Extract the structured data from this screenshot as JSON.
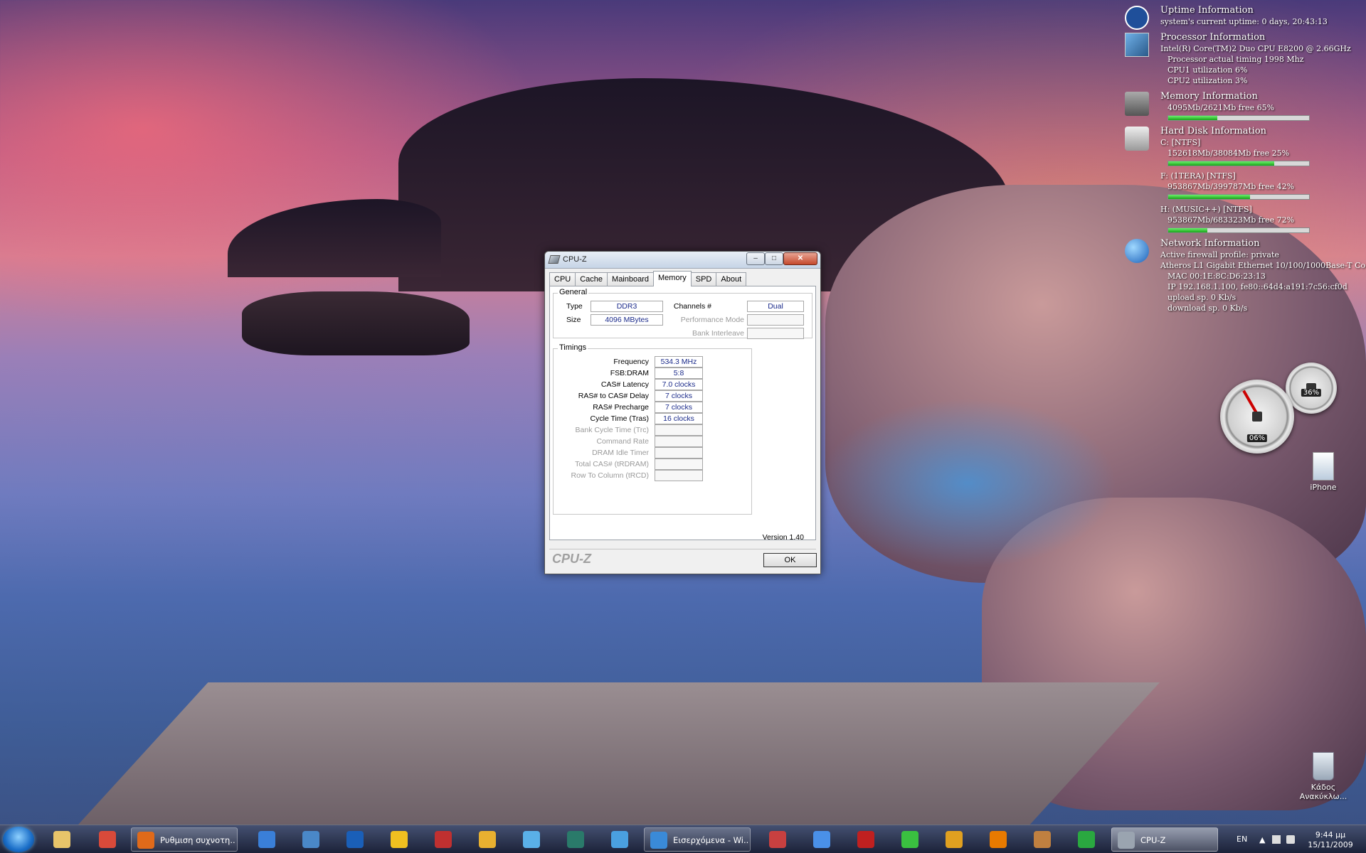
{
  "window": {
    "title": "CPU-Z",
    "tabs": [
      "CPU",
      "Cache",
      "Mainboard",
      "Memory",
      "SPD",
      "About"
    ],
    "active_tab": "Memory",
    "general": {
      "legend": "General",
      "type_label": "Type",
      "type_value": "DDR3",
      "size_label": "Size",
      "size_value": "4096 MBytes",
      "channels_label": "Channels #",
      "channels_value": "Dual",
      "perf_mode_label": "Performance Mode",
      "bank_interleave_label": "Bank Interleave"
    },
    "timings": {
      "legend": "Timings",
      "rows": [
        {
          "label": "Frequency",
          "value": "534.3 MHz",
          "enabled": true
        },
        {
          "label": "FSB:DRAM",
          "value": "5:8",
          "enabled": true
        },
        {
          "label": "CAS# Latency",
          "value": "7.0 clocks",
          "enabled": true
        },
        {
          "label": "RAS# to CAS# Delay",
          "value": "7 clocks",
          "enabled": true
        },
        {
          "label": "RAS# Precharge",
          "value": "7 clocks",
          "enabled": true
        },
        {
          "label": "Cycle Time (Tras)",
          "value": "16 clocks",
          "enabled": true
        },
        {
          "label": "Bank Cycle Time (Trc)",
          "value": "",
          "enabled": false
        },
        {
          "label": "Command Rate",
          "value": "",
          "enabled": false
        },
        {
          "label": "DRAM Idle Timer",
          "value": "",
          "enabled": false
        },
        {
          "label": "Total CAS# (tRDRAM)",
          "value": "",
          "enabled": false
        },
        {
          "label": "Row To Column (tRCD)",
          "value": "",
          "enabled": false
        }
      ]
    },
    "version": "Version 1.40",
    "brand": "CPU-Z",
    "ok_label": "OK"
  },
  "gadget": {
    "uptime": {
      "title": "Uptime Information",
      "line": "system's current uptime: 0 days, 20:43:13"
    },
    "processor": {
      "title": "Processor Information",
      "lines": [
        "Intel(R) Core(TM)2 Duo CPU     E8200  @ 2.66GHz",
        "Processor actual timing 1998 Mhz",
        "CPU1 utilization     6%",
        "CPU2 utilization     3%"
      ]
    },
    "memory": {
      "title": "Memory Information",
      "line": "4095Mb/2621Mb  free 65%",
      "used_fraction": 0.35
    },
    "disk": {
      "title": "Hard Disk Information",
      "drives": [
        {
          "name": "C: [NTFS]",
          "line": "152618Mb/38084Mb  free 25%",
          "used_fraction": 0.75
        },
        {
          "name": "F: (1TERA)  [NTFS]",
          "line": "953867Mb/399787Mb  free 42%",
          "used_fraction": 0.58
        },
        {
          "name": "H: (MUSIC++)  [NTFS]",
          "line": "953867Mb/683323Mb  free 72%",
          "used_fraction": 0.28
        }
      ]
    },
    "network": {
      "title": "Network Information",
      "lines": [
        "Active firewall profile: private",
        "Atheros L1 Gigabit Ethernet 10/100/1000Base-T Co",
        "MAC 00:1E:8C:D6:23:13",
        "IP  192.168.1.100, fe80::64d4:a191:7c56:cf0d",
        "upload sp.      0 Kb/s",
        "download sp.   0 Kb/s"
      ]
    },
    "gauge_cpu": "06%",
    "gauge_mem": "36%"
  },
  "desktop_icons": [
    "iPhone",
    "Κάδος Ανακύκλω..."
  ],
  "taskbar": {
    "windows": [
      {
        "label": "Ρυθμιση συχνοτη...",
        "color": "#e06a1a"
      },
      {
        "label": "Εισερχόμενα - Wi...",
        "color": "#3a8ad8"
      },
      {
        "label": "CPU-Z",
        "color": "#9aa4b0"
      }
    ],
    "pinned_colors": [
      "#e8c46a",
      "#d94a3a",
      "#3a7fd8",
      "#4a88c8",
      "#1a5fb8",
      "#f0c020",
      "#c03030",
      "#e8b030",
      "#5ab0e8",
      "#2a7a6a",
      "#4aa0e0",
      "#c84040",
      "#4a90e8",
      "#c02020",
      "#3ac040",
      "#e0a020",
      "#e87a00",
      "#c08040",
      "#2aa840"
    ],
    "lang": "EN",
    "time": "9:44 μμ",
    "date": "15/11/2009"
  }
}
